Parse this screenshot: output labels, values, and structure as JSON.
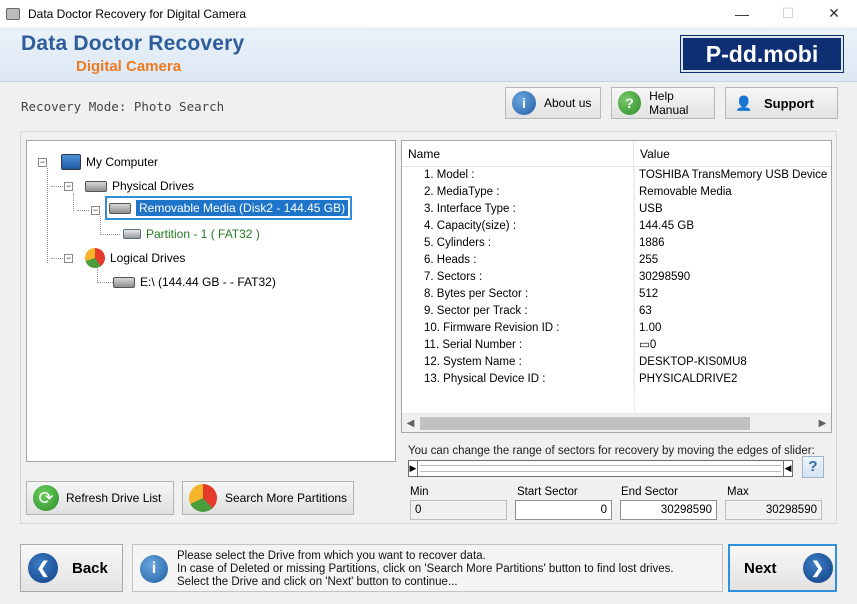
{
  "window": {
    "title": "Data Doctor Recovery for Digital Camera",
    "min": "—",
    "max": "☐",
    "close": "✕"
  },
  "banner": {
    "title": "Data Doctor Recovery",
    "subtitle": "Digital Camera",
    "logo": "P-dd.mobi"
  },
  "mode": {
    "text": "Recovery Mode: Photo Search"
  },
  "buttons": {
    "about": "About us",
    "help": "Help Manual",
    "support": "Support",
    "refresh": "Refresh Drive List",
    "search_more": "Search More Partitions",
    "back": "Back",
    "next": "Next"
  },
  "tree": {
    "root": "My Computer",
    "physical": "Physical Drives",
    "removable": "Removable Media (Disk2 - 144.45 GB)",
    "partition": "Partition - 1 ( FAT32 )",
    "logical": "Logical Drives",
    "drive_e": "E:\\ (144.44 GB -  - FAT32)"
  },
  "props": {
    "headers": {
      "name": "Name",
      "value": "Value"
    },
    "rows": [
      {
        "name": "1. Model :",
        "value": "TOSHIBA TransMemory USB Device"
      },
      {
        "name": "2. MediaType :",
        "value": "Removable Media"
      },
      {
        "name": "3. Interface Type :",
        "value": "USB"
      },
      {
        "name": "4. Capacity(size) :",
        "value": "144.45 GB"
      },
      {
        "name": "5. Cylinders :",
        "value": "1886"
      },
      {
        "name": "6. Heads :",
        "value": "255"
      },
      {
        "name": "7. Sectors :",
        "value": "30298590"
      },
      {
        "name": "8. Bytes per Sector :",
        "value": "512"
      },
      {
        "name": "9. Sector per Track :",
        "value": "63"
      },
      {
        "name": "10. Firmware Revision ID :",
        "value": "1.00"
      },
      {
        "name": "11. Serial Number :",
        "value": "▭0"
      },
      {
        "name": "12. System Name :",
        "value": "DESKTOP-KIS0MU8"
      },
      {
        "name": "13. Physical Device ID :",
        "value": "PHYSICALDRIVE2"
      }
    ]
  },
  "slider": {
    "note": "You can change the range of sectors for recovery by moving the edges of slider:",
    "help": "?",
    "min_label": "Min",
    "start_label": "Start Sector",
    "end_label": "End Sector",
    "max_label": "Max",
    "min_value": "0",
    "start_value": "0",
    "end_value": "30298590",
    "max_value": "30298590"
  },
  "message": {
    "line1": "Please select the Drive from which you want to recover data.",
    "line2": "In case of Deleted or missing Partitions, click on 'Search More Partitions' button to find lost drives.",
    "line3": "Select the Drive and click on 'Next' button to continue..."
  }
}
